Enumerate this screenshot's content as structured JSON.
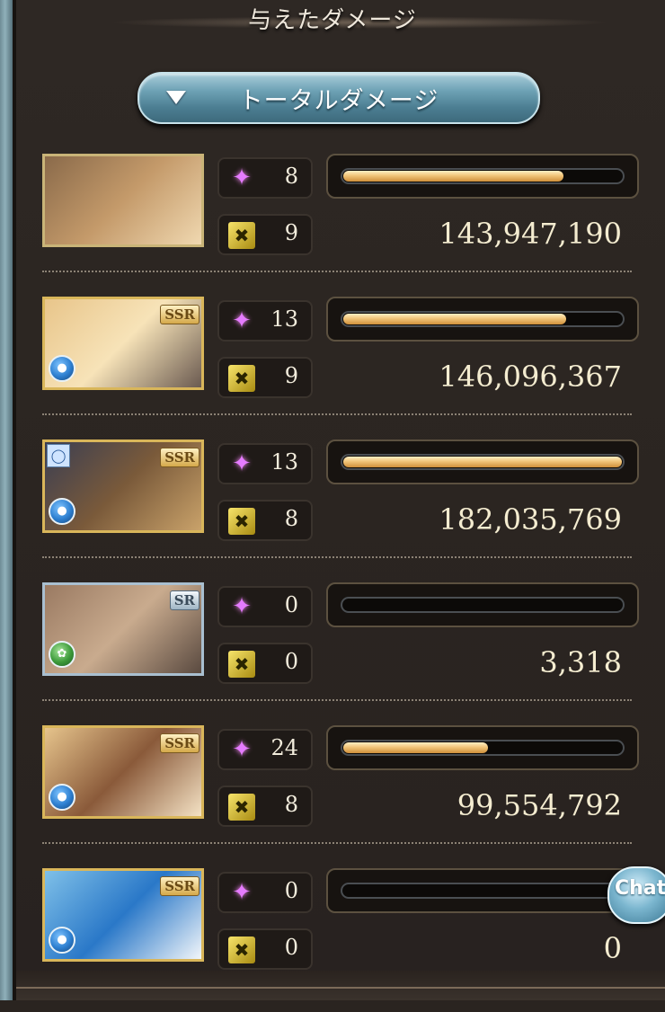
{
  "header": {
    "title": "与えたダメージ"
  },
  "dropdown": {
    "label": "トータルダメージ"
  },
  "characters": [
    {
      "ougi": "8",
      "skill": "9",
      "damage": "143,947,190",
      "bar_fraction": 0.79,
      "rarity": "",
      "element": "",
      "colors": [
        "#8a6a4a",
        "#c49a6a",
        "#f0d8b0"
      ]
    },
    {
      "ougi": "13",
      "skill": "9",
      "damage": "146,096,367",
      "bar_fraction": 0.8,
      "rarity": "SSR",
      "element": "water",
      "colors": [
        "#e8c58a",
        "#f7e3b8",
        "#6a5a50"
      ]
    },
    {
      "ougi": "13",
      "skill": "8",
      "damage": "182,035,769",
      "bar_fraction": 1.0,
      "rarity": "SSR",
      "element": "water",
      "colors": [
        "#3a3e52",
        "#7a5a3a",
        "#c9a26a"
      ]
    },
    {
      "ougi": "0",
      "skill": "0",
      "damage": "3,318",
      "bar_fraction": 0.0,
      "rarity": "SR",
      "element": "wind",
      "colors": [
        "#9a7a62",
        "#c9ab8e",
        "#5a4a40"
      ]
    },
    {
      "ougi": "24",
      "skill": "8",
      "damage": "99,554,792",
      "bar_fraction": 0.52,
      "rarity": "SSR",
      "element": "water",
      "colors": [
        "#e6c48c",
        "#8a5a3a",
        "#f4e2c4"
      ]
    },
    {
      "ougi": "0",
      "skill": "0",
      "damage": "0",
      "bar_fraction": 0.0,
      "rarity": "SSR",
      "element": "water",
      "colors": [
        "#7fc0e8",
        "#2a78c8",
        "#f2f6fa"
      ]
    }
  ],
  "chat_button": {
    "label": "Chat"
  },
  "icons": {
    "ougi": "purple-sparkle-icon",
    "skill": "gold-skill-icon",
    "element_water": "water-element-icon",
    "element_wind": "wind-element-icon",
    "dropdown": "triangle-down-icon"
  },
  "accent_colors": {
    "bar_fill": "#f1c57a",
    "portrait_frame_gold": "#d9b65a",
    "dropdown_blue": "#6ea2b5"
  }
}
